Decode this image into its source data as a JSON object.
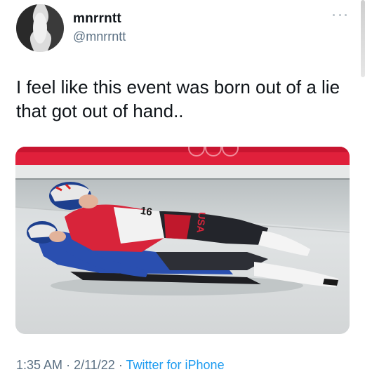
{
  "user": {
    "display_name": "mnrrntt",
    "handle": "@mnrrntt",
    "avatar_icon": "avatar-face-profile-icon"
  },
  "tweet": {
    "text": "I feel like this event was born out of a lie that got out of hand..",
    "more_icon": "more-options-icon"
  },
  "media": {
    "bib_number": "16",
    "suit_text": "USA"
  },
  "meta": {
    "time": "1:35 AM",
    "separator_1": "·",
    "date": "2/11/22",
    "separator_2": "·",
    "source": "Twitter for iPhone"
  },
  "colors": {
    "text_primary": "#0f1419",
    "text_secondary": "#5b7083",
    "link": "#1d9bf0"
  }
}
